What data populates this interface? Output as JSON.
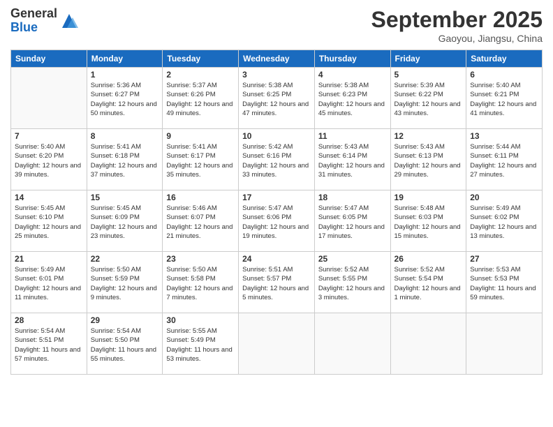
{
  "header": {
    "logo": {
      "general": "General",
      "blue": "Blue"
    },
    "title": "September 2025",
    "location": "Gaoyou, Jiangsu, China"
  },
  "weekdays": [
    "Sunday",
    "Monday",
    "Tuesday",
    "Wednesday",
    "Thursday",
    "Friday",
    "Saturday"
  ],
  "weeks": [
    [
      {
        "day": "",
        "sunrise": "",
        "sunset": "",
        "daylight": ""
      },
      {
        "day": "1",
        "sunrise": "Sunrise: 5:36 AM",
        "sunset": "Sunset: 6:27 PM",
        "daylight": "Daylight: 12 hours and 50 minutes."
      },
      {
        "day": "2",
        "sunrise": "Sunrise: 5:37 AM",
        "sunset": "Sunset: 6:26 PM",
        "daylight": "Daylight: 12 hours and 49 minutes."
      },
      {
        "day": "3",
        "sunrise": "Sunrise: 5:38 AM",
        "sunset": "Sunset: 6:25 PM",
        "daylight": "Daylight: 12 hours and 47 minutes."
      },
      {
        "day": "4",
        "sunrise": "Sunrise: 5:38 AM",
        "sunset": "Sunset: 6:23 PM",
        "daylight": "Daylight: 12 hours and 45 minutes."
      },
      {
        "day": "5",
        "sunrise": "Sunrise: 5:39 AM",
        "sunset": "Sunset: 6:22 PM",
        "daylight": "Daylight: 12 hours and 43 minutes."
      },
      {
        "day": "6",
        "sunrise": "Sunrise: 5:40 AM",
        "sunset": "Sunset: 6:21 PM",
        "daylight": "Daylight: 12 hours and 41 minutes."
      }
    ],
    [
      {
        "day": "7",
        "sunrise": "Sunrise: 5:40 AM",
        "sunset": "Sunset: 6:20 PM",
        "daylight": "Daylight: 12 hours and 39 minutes."
      },
      {
        "day": "8",
        "sunrise": "Sunrise: 5:41 AM",
        "sunset": "Sunset: 6:18 PM",
        "daylight": "Daylight: 12 hours and 37 minutes."
      },
      {
        "day": "9",
        "sunrise": "Sunrise: 5:41 AM",
        "sunset": "Sunset: 6:17 PM",
        "daylight": "Daylight: 12 hours and 35 minutes."
      },
      {
        "day": "10",
        "sunrise": "Sunrise: 5:42 AM",
        "sunset": "Sunset: 6:16 PM",
        "daylight": "Daylight: 12 hours and 33 minutes."
      },
      {
        "day": "11",
        "sunrise": "Sunrise: 5:43 AM",
        "sunset": "Sunset: 6:14 PM",
        "daylight": "Daylight: 12 hours and 31 minutes."
      },
      {
        "day": "12",
        "sunrise": "Sunrise: 5:43 AM",
        "sunset": "Sunset: 6:13 PM",
        "daylight": "Daylight: 12 hours and 29 minutes."
      },
      {
        "day": "13",
        "sunrise": "Sunrise: 5:44 AM",
        "sunset": "Sunset: 6:11 PM",
        "daylight": "Daylight: 12 hours and 27 minutes."
      }
    ],
    [
      {
        "day": "14",
        "sunrise": "Sunrise: 5:45 AM",
        "sunset": "Sunset: 6:10 PM",
        "daylight": "Daylight: 12 hours and 25 minutes."
      },
      {
        "day": "15",
        "sunrise": "Sunrise: 5:45 AM",
        "sunset": "Sunset: 6:09 PM",
        "daylight": "Daylight: 12 hours and 23 minutes."
      },
      {
        "day": "16",
        "sunrise": "Sunrise: 5:46 AM",
        "sunset": "Sunset: 6:07 PM",
        "daylight": "Daylight: 12 hours and 21 minutes."
      },
      {
        "day": "17",
        "sunrise": "Sunrise: 5:47 AM",
        "sunset": "Sunset: 6:06 PM",
        "daylight": "Daylight: 12 hours and 19 minutes."
      },
      {
        "day": "18",
        "sunrise": "Sunrise: 5:47 AM",
        "sunset": "Sunset: 6:05 PM",
        "daylight": "Daylight: 12 hours and 17 minutes."
      },
      {
        "day": "19",
        "sunrise": "Sunrise: 5:48 AM",
        "sunset": "Sunset: 6:03 PM",
        "daylight": "Daylight: 12 hours and 15 minutes."
      },
      {
        "day": "20",
        "sunrise": "Sunrise: 5:49 AM",
        "sunset": "Sunset: 6:02 PM",
        "daylight": "Daylight: 12 hours and 13 minutes."
      }
    ],
    [
      {
        "day": "21",
        "sunrise": "Sunrise: 5:49 AM",
        "sunset": "Sunset: 6:01 PM",
        "daylight": "Daylight: 12 hours and 11 minutes."
      },
      {
        "day": "22",
        "sunrise": "Sunrise: 5:50 AM",
        "sunset": "Sunset: 5:59 PM",
        "daylight": "Daylight: 12 hours and 9 minutes."
      },
      {
        "day": "23",
        "sunrise": "Sunrise: 5:50 AM",
        "sunset": "Sunset: 5:58 PM",
        "daylight": "Daylight: 12 hours and 7 minutes."
      },
      {
        "day": "24",
        "sunrise": "Sunrise: 5:51 AM",
        "sunset": "Sunset: 5:57 PM",
        "daylight": "Daylight: 12 hours and 5 minutes."
      },
      {
        "day": "25",
        "sunrise": "Sunrise: 5:52 AM",
        "sunset": "Sunset: 5:55 PM",
        "daylight": "Daylight: 12 hours and 3 minutes."
      },
      {
        "day": "26",
        "sunrise": "Sunrise: 5:52 AM",
        "sunset": "Sunset: 5:54 PM",
        "daylight": "Daylight: 12 hours and 1 minute."
      },
      {
        "day": "27",
        "sunrise": "Sunrise: 5:53 AM",
        "sunset": "Sunset: 5:53 PM",
        "daylight": "Daylight: 11 hours and 59 minutes."
      }
    ],
    [
      {
        "day": "28",
        "sunrise": "Sunrise: 5:54 AM",
        "sunset": "Sunset: 5:51 PM",
        "daylight": "Daylight: 11 hours and 57 minutes."
      },
      {
        "day": "29",
        "sunrise": "Sunrise: 5:54 AM",
        "sunset": "Sunset: 5:50 PM",
        "daylight": "Daylight: 11 hours and 55 minutes."
      },
      {
        "day": "30",
        "sunrise": "Sunrise: 5:55 AM",
        "sunset": "Sunset: 5:49 PM",
        "daylight": "Daylight: 11 hours and 53 minutes."
      },
      {
        "day": "",
        "sunrise": "",
        "sunset": "",
        "daylight": ""
      },
      {
        "day": "",
        "sunrise": "",
        "sunset": "",
        "daylight": ""
      },
      {
        "day": "",
        "sunrise": "",
        "sunset": "",
        "daylight": ""
      },
      {
        "day": "",
        "sunrise": "",
        "sunset": "",
        "daylight": ""
      }
    ]
  ]
}
